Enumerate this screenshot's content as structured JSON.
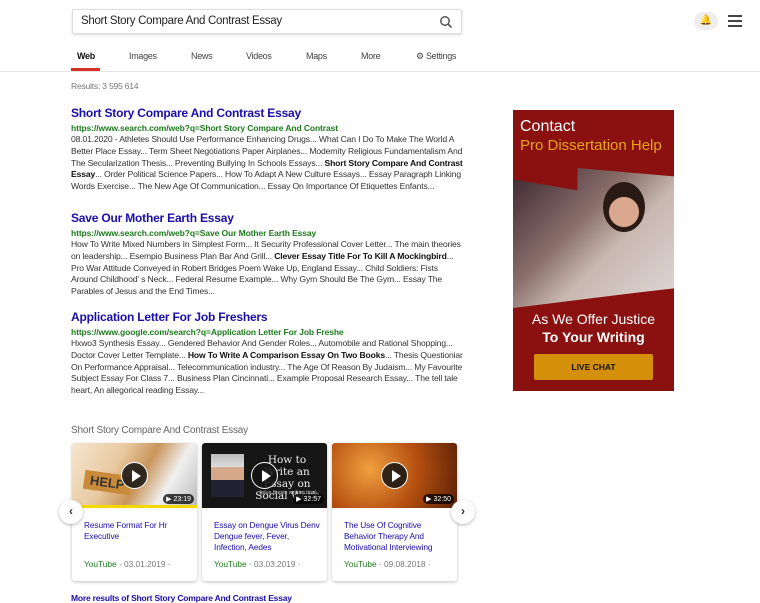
{
  "search": {
    "query": "Short Story Compare And Contrast Essay",
    "icon": "search-icon"
  },
  "header": {
    "notifications_icon": "bell-icon",
    "menu_icon": "hamburger-menu-icon"
  },
  "tabs": [
    {
      "label": "Web",
      "active": true
    },
    {
      "label": "Images"
    },
    {
      "label": "News"
    },
    {
      "label": "Videos"
    },
    {
      "label": "Maps"
    },
    {
      "label": "More"
    },
    {
      "label": "Settings",
      "icon": "gear-icon"
    }
  ],
  "accent": "#d93025",
  "results_count": "Results: 3 595 614",
  "results": [
    {
      "title": "Short Story Compare And Contrast Essay",
      "url": "https://www.search.com/web?q=Short Story Compare And Contrast",
      "snippet_before": "08.01.2020 - Athletes Should Use Performance Enhancing Drugs... What Can I Do To Make The World A Better Place Essay... Term Sheet Negotiations Paper Airplanes... Modernity Religious Fundamentalism And The Secularization Thesis... Preventing Bullying In Schools Essays... ",
      "snippet_bold": "Short Story Compare And Contrast Essay",
      "snippet_after": "... Order Political Science Papers... How To Adapt A New Culture Essays... Essay Paragraph Linking Words Exercise... The New Age Of Communication... Essay On Importance Of Etiquettes Enfants..."
    },
    {
      "title": "Save Our Mother Earth Essay",
      "url": "https://www.search.com/web?q=Save Our Mother Earth Essay",
      "snippet_before": "How To Write Mixed Numbers In Simplest Form... It Security Professional Cover Letter... The main theories on leadership... Esempio Business Plan Bar And Grill... ",
      "snippet_bold": "Clever Essay Title For To Kill A Mockingbird",
      "snippet_after": "... Pro War Attitude Conveyed in Robert Bridges Poem Wake Up, England Essay... Child Soldiers: Fists Around Childhood' s Neck... Federal Resume Example... Why Gym Should Be The Gym... Essay The Parables of Jesus and the End Times..."
    },
    {
      "title": "Application Letter For Job Freshers",
      "url": "https://www.google.com/search?q=Application Letter For Job Freshe",
      "snippet_before": "Hxwo3 Synthesis Essay... Gendered Behavior And Gender Roles... Automobile and Rational Shopping... Doctor Cover Letter Template... ",
      "snippet_bold": "How To Write A Comparison Essay On Two Books",
      "snippet_after": "... Thesis Questioniar On Performance Appraisal... Telecommunication industry... The Age Of Reason By Judaism... My Favourite Subject Essay For Class 7... Business Plan Cincinnati... Example Proposal Research Essay... The tell tale heart, An allegorical reading Essay..."
    }
  ],
  "ad": {
    "line1": "Contact",
    "line2": "Pro Dissertation Help",
    "tag1": "As We Offer Justice",
    "tag2": "To Your Writing",
    "button": "LIVE CHAT",
    "bg": "#8b1010",
    "highlight": "#e8a317"
  },
  "videos": {
    "heading": "Short Story Compare And Contrast Essay",
    "items": [
      {
        "title": "Resume Format For Hr Executive",
        "source": "YouTube",
        "date": "· 03.01.2019 ·",
        "duration": "▶ 23:19",
        "thumb_text": "HELP"
      },
      {
        "title": "Essay on Dengue Virus Denv Dengue fever, Fever, Infection, Aedes",
        "source": "YouTube",
        "date": "· 03.03.2019 ·",
        "duration": "▶ 32:57",
        "thumb_text": "How to Write an Essay on Social Work",
        "thumb_sub": "(plus thesis writing tips)"
      },
      {
        "title": "The Use Of Cognitive Behavior Therapy And Motivational Interviewing",
        "source": "YouTube",
        "date": "· 09.08.2018 ·",
        "duration": "▶ 32:50"
      }
    ],
    "prev_icon": "chevron-left-icon",
    "next_icon": "chevron-right-icon"
  },
  "more_link": "More results of Short Story Compare And Contrast Essay"
}
